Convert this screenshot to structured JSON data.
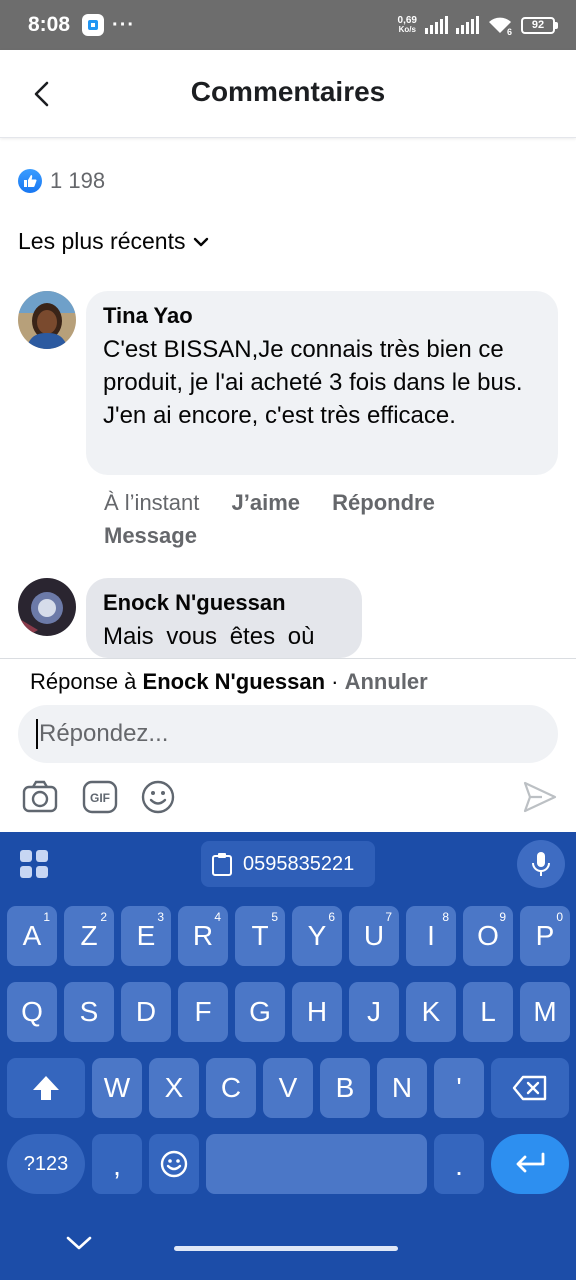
{
  "status_bar": {
    "time": "8:08",
    "dots": "···",
    "net_speed_value": "0,69",
    "net_speed_unit": "Ko/s",
    "wifi_badge": "6",
    "battery": "92"
  },
  "header": {
    "title": "Commentaires"
  },
  "reactions": {
    "count": "1 198"
  },
  "sort": {
    "label": "Les plus récents"
  },
  "comments": [
    {
      "author": "Tina Yao",
      "text": "C'est BISSAN,Je connais très bien ce produit, je l'ai acheté 3 fois dans le bus. J'en ai encore, c'est très efficace."
    },
    {
      "author": "Enock N'guessan",
      "text": "Mais vous êtes où"
    }
  ],
  "comment_actions": {
    "time": "À l’instant",
    "like": "J’aime",
    "reply": "Répondre",
    "message": "Message"
  },
  "reply": {
    "prefix": "Réponse à ",
    "target": "Enock N'guessan",
    "separator": " · ",
    "cancel": "Annuler",
    "placeholder": "Répondez..."
  },
  "keyboard": {
    "clipboard": "0595835221",
    "row1": [
      [
        "A",
        "1"
      ],
      [
        "Z",
        "2"
      ],
      [
        "E",
        "3"
      ],
      [
        "R",
        "4"
      ],
      [
        "T",
        "5"
      ],
      [
        "Y",
        "6"
      ],
      [
        "U",
        "7"
      ],
      [
        "I",
        "8"
      ],
      [
        "O",
        "9"
      ],
      [
        "P",
        "0"
      ]
    ],
    "row2": [
      "Q",
      "S",
      "D",
      "F",
      "G",
      "H",
      "J",
      "K",
      "L",
      "M"
    ],
    "row3": [
      "W",
      "X",
      "C",
      "V",
      "B",
      "N",
      "'"
    ],
    "numbers_key": "?123",
    "comma": ",",
    "period": "."
  },
  "colors": {
    "accent": "#1877f2",
    "keyboard_bg": "#1c4da8",
    "key_bg": "#4b77c7",
    "bubble_bg": "#f0f2f5"
  }
}
